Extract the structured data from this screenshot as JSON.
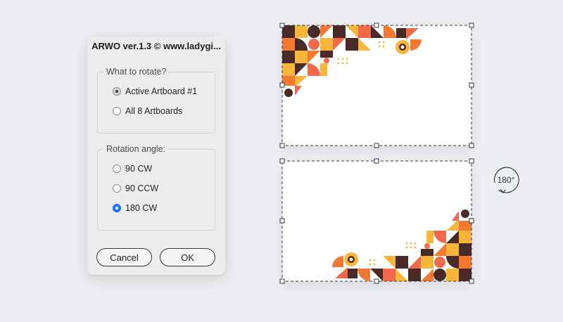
{
  "dialog": {
    "title": "ARWO ver.1.3 © www.ladygi...",
    "rotate_group": {
      "legend": "What to rotate?",
      "options": [
        {
          "label": "Active Artboard #1",
          "selected": true
        },
        {
          "label": "All 8 Artboards",
          "selected": false
        }
      ]
    },
    "angle_group": {
      "legend": "Rotation angle:",
      "options": [
        {
          "label": "90 CW",
          "selected": false
        },
        {
          "label": "90 CCW",
          "selected": false
        },
        {
          "label": "180 CW",
          "selected": true
        }
      ]
    },
    "cancel_label": "Cancel",
    "ok_label": "OK"
  },
  "rotation_badge": "180°",
  "colors": {
    "background": "#edeef1",
    "dark_brown": "#4a2a27",
    "orange": "#f47a34",
    "coral": "#f26a4b",
    "yellow": "#f8b73a",
    "selection": "#2b3a4e",
    "radio_selected": "#1b7cf4"
  },
  "icons": {
    "rotation": "rotate-180-icon",
    "radio": "radio-button-icon"
  }
}
